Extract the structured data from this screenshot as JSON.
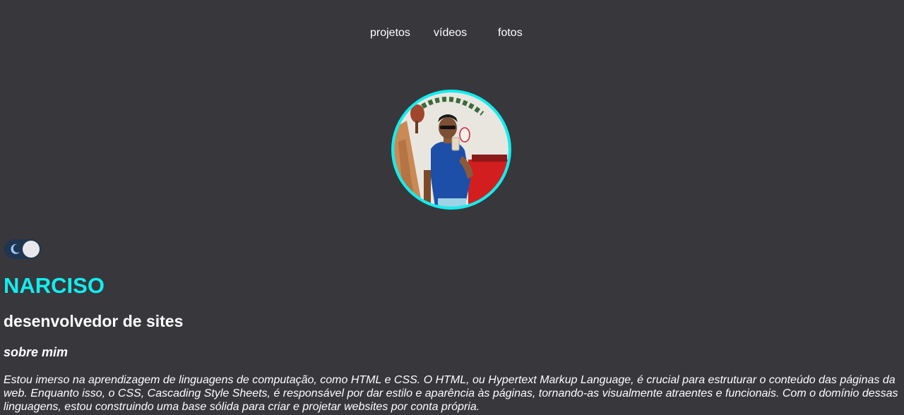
{
  "nav": {
    "items": [
      {
        "label": "projetos"
      },
      {
        "label": "vídeos"
      },
      {
        "label": "fotos"
      }
    ]
  },
  "profile": {
    "photo_icon": "profile-photo",
    "accent_color": "#11eeee"
  },
  "theme_toggle": {
    "icon": "moon-icon",
    "state": "dark"
  },
  "hero": {
    "name": "NARCISO",
    "role": "desenvolvedor de sites"
  },
  "about": {
    "title": "sobre mim",
    "text": "Estou imerso na aprendizagem de linguagens de computação, como HTML e CSS. O HTML, ou Hypertext Markup Language, é crucial para estruturar o conteúdo das páginas da web. Enquanto isso, o CSS, Cascading Style Sheets, é responsável por dar estilo e aparência às páginas, tornando-as visualmente atraentes e funcionais. Com o domínio dessas linguagens, estou construindo uma base sólida para criar e projetar websites por conta própria."
  }
}
